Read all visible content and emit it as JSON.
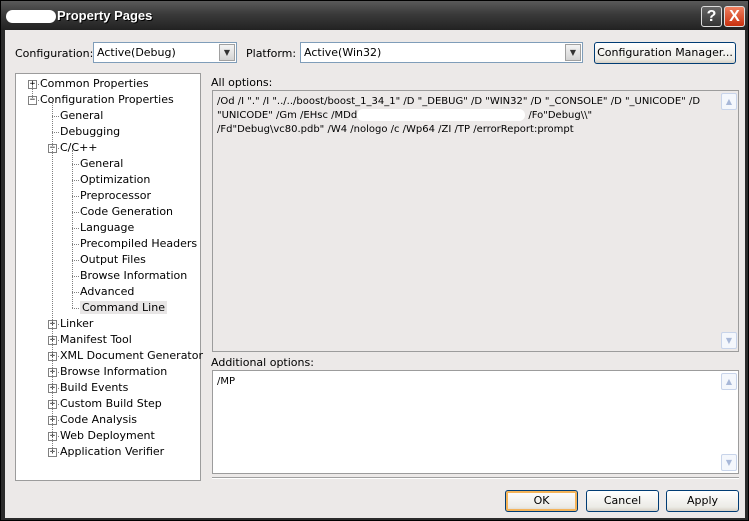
{
  "window": {
    "title": "Property Pages",
    "title_prefix_redacted": true,
    "help_label": "?",
    "close_label": "X"
  },
  "toolbar": {
    "configuration_label": "Configuration:",
    "configuration_value": "Active(Debug)",
    "platform_label": "Platform:",
    "platform_value": "Active(Win32)",
    "config_manager_label": "Configuration Manager..."
  },
  "tree": {
    "items": [
      {
        "label": "Common Properties",
        "level": 0,
        "expander": "+"
      },
      {
        "label": "Configuration Properties",
        "level": 0,
        "expander": "-"
      },
      {
        "label": "General",
        "level": 1,
        "expander": null
      },
      {
        "label": "Debugging",
        "level": 1,
        "expander": null
      },
      {
        "label": "C/C++",
        "level": 1,
        "expander": "-"
      },
      {
        "label": "General",
        "level": 2,
        "expander": null
      },
      {
        "label": "Optimization",
        "level": 2,
        "expander": null
      },
      {
        "label": "Preprocessor",
        "level": 2,
        "expander": null
      },
      {
        "label": "Code Generation",
        "level": 2,
        "expander": null
      },
      {
        "label": "Language",
        "level": 2,
        "expander": null
      },
      {
        "label": "Precompiled Headers",
        "level": 2,
        "expander": null
      },
      {
        "label": "Output Files",
        "level": 2,
        "expander": null
      },
      {
        "label": "Browse Information",
        "level": 2,
        "expander": null
      },
      {
        "label": "Advanced",
        "level": 2,
        "expander": null
      },
      {
        "label": "Command Line",
        "level": 2,
        "expander": null,
        "selected": true
      },
      {
        "label": "Linker",
        "level": 1,
        "expander": "+"
      },
      {
        "label": "Manifest Tool",
        "level": 1,
        "expander": "+"
      },
      {
        "label": "XML Document Generator",
        "level": 1,
        "expander": "+"
      },
      {
        "label": "Browse Information",
        "level": 1,
        "expander": "+"
      },
      {
        "label": "Build Events",
        "level": 1,
        "expander": "+"
      },
      {
        "label": "Custom Build Step",
        "level": 1,
        "expander": "+"
      },
      {
        "label": "Code Analysis",
        "level": 1,
        "expander": "+"
      },
      {
        "label": "Web Deployment",
        "level": 1,
        "expander": "+"
      },
      {
        "label": "Application Verifier",
        "level": 1,
        "expander": "+"
      }
    ]
  },
  "all_options": {
    "label": "All options:",
    "lines": [
      "/Od /I \".\" /I \"../../boost/boost_1_34_1\" /D \"_DEBUG\" /D \"WIN32\" /D \"_CONSOLE\" /D \"_UNICODE\" /D",
      "\"UNICODE\" /Gm /EHsc /MDd",
      "/Fo\"Debug\\\\\"",
      "/Fd\"Debug\\vc80.pdb\" /W4 /nologo /c /Wp64 /ZI /TP /errorReport:prompt"
    ]
  },
  "additional_options": {
    "label": "Additional options:",
    "value": "/MP"
  },
  "buttons": {
    "ok": "OK",
    "cancel": "Cancel",
    "apply": "Apply"
  }
}
